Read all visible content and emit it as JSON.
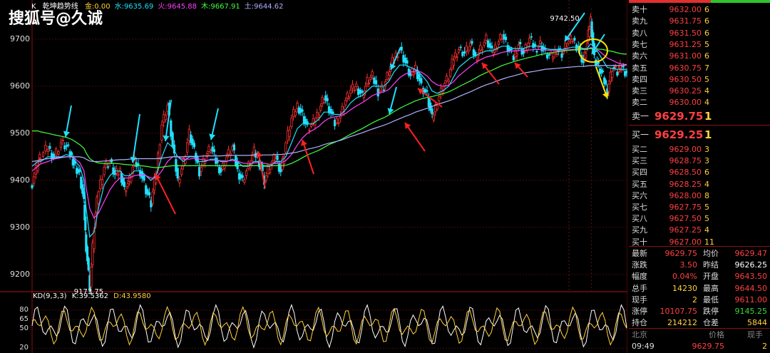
{
  "watermark": "搜狐号@久诚",
  "legend": {
    "prefix": "K",
    "indicator": "乾坤趋势线",
    "items": [
      {
        "label": "金:0.00",
        "color": "#ffd23a"
      },
      {
        "label": "水:9635.69",
        "color": "#20e0ff"
      },
      {
        "label": "火:9645.88",
        "color": "#ff40ff"
      },
      {
        "label": "木:9667.91",
        "color": "#40ff40"
      },
      {
        "label": "土:9644.62",
        "color": "#b0b0ff"
      }
    ]
  },
  "kd_legend": {
    "title": "KD(9,3,3)",
    "k": "K:39.5362",
    "d": "D:43.9580"
  },
  "chart_data": [
    {
      "type": "line",
      "name": "price",
      "ylim": [
        9165,
        9765
      ],
      "yticks": [
        9200,
        9300,
        9400,
        9500,
        9600,
        9700
      ],
      "grid": true,
      "x": [
        0,
        8,
        12,
        22,
        30,
        40,
        48,
        55,
        60,
        66,
        72,
        75,
        80,
        86,
        92,
        100,
        108,
        115,
        122,
        128,
        135,
        142,
        150,
        158,
        165,
        172,
        180,
        188,
        195,
        202,
        210,
        218,
        225,
        232,
        240,
        248,
        255,
        262,
        270,
        278,
        285,
        292,
        300,
        308,
        315,
        322,
        330,
        338,
        345,
        352,
        360,
        368,
        375,
        382,
        390,
        398,
        405,
        412,
        420,
        428,
        435,
        442,
        450,
        458,
        465,
        472,
        480,
        488,
        495,
        502,
        510,
        518,
        525,
        532,
        540,
        548,
        555,
        562,
        570,
        578,
        585,
        592,
        600,
        608,
        615,
        622,
        630,
        638,
        645,
        652,
        660,
        668,
        675,
        682,
        690,
        698,
        705,
        712,
        720,
        728,
        735,
        742,
        750,
        758,
        765,
        770,
        775,
        780,
        786,
        792,
        798,
        805,
        812,
        818,
        825
      ],
      "values": [
        9395,
        9440,
        9450,
        9470,
        9450,
        9480,
        9470,
        9450,
        9430,
        9410,
        9350,
        9260,
        9174,
        9300,
        9380,
        9430,
        9440,
        9410,
        9420,
        9380,
        9400,
        9440,
        9420,
        9380,
        9350,
        9420,
        9520,
        9560,
        9470,
        9400,
        9440,
        9500,
        9460,
        9420,
        9450,
        9470,
        9440,
        9420,
        9450,
        9470,
        9420,
        9400,
        9430,
        9460,
        9440,
        9400,
        9430,
        9450,
        9420,
        9480,
        9530,
        9560,
        9540,
        9510,
        9520,
        9550,
        9580,
        9550,
        9520,
        9540,
        9570,
        9590,
        9600,
        9580,
        9610,
        9620,
        9590,
        9600,
        9630,
        9660,
        9680,
        9650,
        9620,
        9640,
        9600,
        9580,
        9530,
        9570,
        9600,
        9620,
        9660,
        9680,
        9670,
        9690,
        9660,
        9680,
        9700,
        9670,
        9690,
        9710,
        9680,
        9660,
        9690,
        9670,
        9700,
        9680,
        9690,
        9670,
        9660,
        9680,
        9670,
        9690,
        9700,
        9680,
        9650,
        9690,
        9742.5,
        9660,
        9640,
        9620,
        9590,
        9640,
        9630,
        9640,
        9630
      ],
      "series_lines": [
        {
          "color": "#20e0ff",
          "values": [
            9430,
            9440,
            9440,
            9450,
            9450,
            9450,
            9455,
            9450,
            9440,
            9430,
            9400,
            9340,
            9280,
            9290,
            9340,
            9390,
            9410,
            9420,
            9420,
            9410,
            9410,
            9420,
            9420,
            9410,
            9400,
            9410,
            9450,
            9480,
            9470,
            9450,
            9440,
            9450,
            9450,
            9440,
            9440,
            9445,
            9445,
            9440,
            9440,
            9445,
            9440,
            9430,
            9430,
            9440,
            9440,
            9430,
            9430,
            9440,
            9440,
            9450,
            9480,
            9510,
            9520,
            9520,
            9520,
            9530,
            9545,
            9545,
            9540,
            9540,
            9550,
            9565,
            9575,
            9580,
            9590,
            9600,
            9600,
            9600,
            9610,
            9630,
            9645,
            9645,
            9640,
            9635,
            9625,
            9610,
            9590,
            9585,
            9590,
            9600,
            9620,
            9640,
            9650,
            9660,
            9665,
            9670,
            9675,
            9675,
            9680,
            9685,
            9685,
            9680,
            9680,
            9680,
            9685,
            9685,
            9685,
            9680,
            9678,
            9678,
            9678,
            9680,
            9683,
            9683,
            9680,
            9680,
            9690,
            9685,
            9670,
            9655,
            9640,
            9638,
            9636,
            9636,
            9636
          ]
        },
        {
          "color": "#ff40ff",
          "values": [
            9420,
            9430,
            9435,
            9440,
            9445,
            9448,
            9450,
            9450,
            9445,
            9438,
            9420,
            9385,
            9340,
            9320,
            9330,
            9355,
            9380,
            9395,
            9405,
            9405,
            9405,
            9410,
            9412,
            9410,
            9405,
            9405,
            9420,
            9440,
            9450,
            9450,
            9445,
            9445,
            9447,
            9445,
            9443,
            9443,
            9443,
            9442,
            9441,
            9442,
            9441,
            9437,
            9435,
            9437,
            9438,
            9436,
            9434,
            9436,
            9437,
            9442,
            9455,
            9475,
            9490,
            9500,
            9507,
            9515,
            9525,
            9532,
            9535,
            9537,
            9542,
            9550,
            9558,
            9565,
            9572,
            9580,
            9585,
            9588,
            9593,
            9605,
            9618,
            9626,
            9630,
            9632,
            9630,
            9622,
            9610,
            9603,
            9600,
            9602,
            9610,
            9622,
            9632,
            9642,
            9650,
            9656,
            9662,
            9665,
            9668,
            9672,
            9674,
            9675,
            9676,
            9676,
            9677,
            9678,
            9678,
            9677,
            9676,
            9676,
            9676,
            9677,
            9678,
            9679,
            9678,
            9678,
            9682,
            9681,
            9676,
            9668,
            9660,
            9655,
            9650,
            9647,
            9646
          ]
        },
        {
          "color": "#40ff40",
          "values": [
            9505,
            9505,
            9503,
            9500,
            9497,
            9494,
            9491,
            9487,
            9482,
            9476,
            9468,
            9458,
            9446,
            9440,
            9437,
            9436,
            9436,
            9436,
            9435,
            9434,
            9433,
            9432,
            9431,
            9430,
            9428,
            9427,
            9428,
            9430,
            9431,
            9431,
            9431,
            9431,
            9431,
            9431,
            9431,
            9431,
            9431,
            9431,
            9431,
            9431,
            9431,
            9431,
            9431,
            9431,
            9431,
            9431,
            9431,
            9431,
            9431,
            9432,
            9436,
            9442,
            9448,
            9454,
            9459,
            9464,
            9470,
            9476,
            9481,
            9486,
            9492,
            9498,
            9504,
            9510,
            9516,
            9522,
            9528,
            9533,
            9539,
            9546,
            9553,
            9559,
            9564,
            9569,
            9573,
            9576,
            9578,
            9581,
            9584,
            9588,
            9593,
            9599,
            9605,
            9611,
            9617,
            9623,
            9629,
            9634,
            9639,
            9644,
            9648,
            9652,
            9655,
            9658,
            9661,
            9664,
            9667,
            9669,
            9671,
            9673,
            9674,
            9676,
            9677,
            9678,
            9679,
            9679,
            9680,
            9680,
            9679,
            9678,
            9676,
            9674,
            9671,
            9669,
            9668
          ]
        },
        {
          "color": "#b0b0ff",
          "values": [
            9440,
            9442,
            9444,
            9446,
            9447,
            9449,
            9450,
            9450,
            9450,
            9450,
            9448,
            9445,
            9441,
            9440,
            9440,
            9441,
            9442,
            9443,
            9444,
            9444,
            9445,
            9446,
            9446,
            9446,
            9446,
            9446,
            9447,
            9449,
            9450,
            9450,
            9450,
            9451,
            9451,
            9451,
            9452,
            9452,
            9452,
            9452,
            9453,
            9453,
            9453,
            9453,
            9453,
            9454,
            9454,
            9454,
            9454,
            9455,
            9455,
            9456,
            9458,
            9460,
            9463,
            9466,
            9469,
            9472,
            9476,
            9479,
            9482,
            9485,
            9489,
            9493,
            9497,
            9501,
            9505,
            9509,
            9513,
            9517,
            9521,
            9526,
            9531,
            9536,
            9540,
            9545,
            9549,
            9553,
            9557,
            9561,
            9565,
            9569,
            9573,
            9578,
            9583,
            9588,
            9593,
            9598,
            9603,
            9607,
            9611,
            9615,
            9619,
            9622,
            9625,
            9628,
            9630,
            9632,
            9634,
            9636,
            9637,
            9638,
            9639,
            9640,
            9641,
            9642,
            9642,
            9643,
            9644,
            9644,
            9644,
            9644,
            9644,
            9644,
            9644,
            9644,
            9645
          ]
        }
      ],
      "annotations": [
        {
          "label": "9173.75",
          "value": 9173.75
        },
        {
          "label": "9742.50",
          "value": 9742.5
        }
      ]
    },
    {
      "type": "line",
      "name": "KD(9,3,3)",
      "ylim": [
        18,
        92
      ],
      "yticks": [
        20,
        50,
        65,
        80
      ]
    }
  ],
  "orderbook": {
    "asks": [
      {
        "label": "卖十",
        "price": "9632.00",
        "vol": "6"
      },
      {
        "label": "卖九",
        "price": "9631.75",
        "vol": "6"
      },
      {
        "label": "卖八",
        "price": "9631.50",
        "vol": "6"
      },
      {
        "label": "卖七",
        "price": "9631.25",
        "vol": "5"
      },
      {
        "label": "卖六",
        "price": "9631.00",
        "vol": "6"
      },
      {
        "label": "卖五",
        "price": "9630.75",
        "vol": "7"
      },
      {
        "label": "卖四",
        "price": "9630.50",
        "vol": "5"
      },
      {
        "label": "卖三",
        "price": "9630.25",
        "vol": "4"
      },
      {
        "label": "卖二",
        "price": "9630.00",
        "vol": "4"
      },
      {
        "label": "卖一",
        "price": "9629.75",
        "vol": "1"
      }
    ],
    "bids": [
      {
        "label": "买一",
        "price": "9629.25",
        "vol": "1"
      },
      {
        "label": "买二",
        "price": "9629.00",
        "vol": "3"
      },
      {
        "label": "买三",
        "price": "9628.75",
        "vol": "3"
      },
      {
        "label": "买四",
        "price": "9628.50",
        "vol": "6"
      },
      {
        "label": "买五",
        "price": "9628.25",
        "vol": "4"
      },
      {
        "label": "买六",
        "price": "9628.00",
        "vol": "8"
      },
      {
        "label": "买七",
        "price": "9627.75",
        "vol": "5"
      },
      {
        "label": "买八",
        "price": "9627.50",
        "vol": "5"
      },
      {
        "label": "买九",
        "price": "9627.25",
        "vol": "4"
      },
      {
        "label": "买十",
        "price": "9627.00",
        "vol": "11"
      }
    ]
  },
  "stats": [
    {
      "k1": "最新",
      "v1": "9629.75",
      "c1": "red",
      "k2": "均价",
      "v2": "9629.47",
      "c2": "red"
    },
    {
      "k1": "涨跌",
      "v1": "3.50",
      "c1": "red",
      "k2": "昨结",
      "v2": "9626.25",
      "c2": "wht"
    },
    {
      "k1": "幅度",
      "v1": "0.04%",
      "c1": "red",
      "k2": "开盘",
      "v2": "9643.50",
      "c2": "red"
    },
    {
      "k1": "总手",
      "v1": "14230",
      "c1": "yel",
      "k2": "最高",
      "v2": "9644.50",
      "c2": "red"
    },
    {
      "k1": "现手",
      "v1": "2",
      "c1": "yel",
      "k2": "最低",
      "v2": "9611.00",
      "c2": "red"
    },
    {
      "k1": "涨停",
      "v1": "10107.75",
      "c1": "red",
      "k2": "跌停",
      "v2": "9145.25",
      "c2": "grn"
    },
    {
      "k1": "持仓",
      "v1": "214212",
      "c1": "yel",
      "k2": "仓差",
      "v2": "5844",
      "c2": "yel"
    }
  ],
  "trades": {
    "headers": [
      "北京",
      "价格",
      "现手"
    ],
    "rows": [
      {
        "time": "09:49",
        "price": "9629.75",
        "vol": "2"
      }
    ]
  }
}
